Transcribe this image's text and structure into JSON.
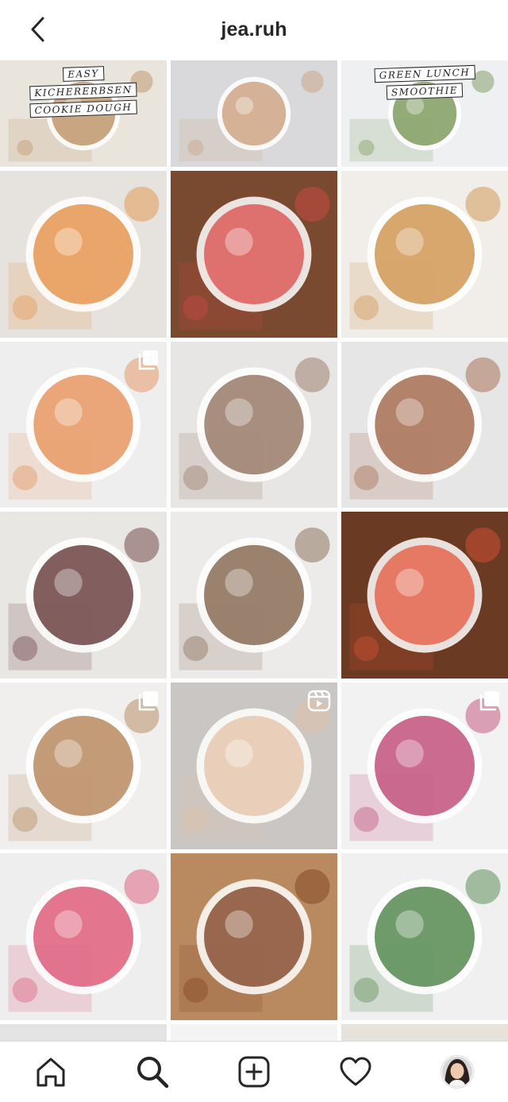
{
  "header": {
    "username": "jea.ruh"
  },
  "posts": [
    {
      "row": 0,
      "col": 0,
      "overlay": [
        "EASY",
        "KICHERERBSEN",
        "COOKIE DOUGH"
      ],
      "badge": "none",
      "bg": "#e9e4dc",
      "accent": "#b88a5a"
    },
    {
      "row": 0,
      "col": 1,
      "overlay": [],
      "badge": "none",
      "bg": "#d9d9dc",
      "accent": "#c89a76"
    },
    {
      "row": 0,
      "col": 2,
      "overlay": [
        "GREEN LUNCH",
        "SMOOTHIE"
      ],
      "badge": "none",
      "bg": "#eef0f2",
      "accent": "#6f8f4a"
    },
    {
      "row": 1,
      "col": 0,
      "overlay": [],
      "badge": "none",
      "bg": "#e6e3df",
      "accent": "#e48a3a"
    },
    {
      "row": 1,
      "col": 1,
      "overlay": [],
      "badge": "none",
      "bg": "#7a4a30",
      "accent": "#d94a48"
    },
    {
      "row": 1,
      "col": 2,
      "overlay": [],
      "badge": "none",
      "bg": "#f1ede8",
      "accent": "#c98a3e"
    },
    {
      "row": 2,
      "col": 0,
      "overlay": [],
      "badge": "carousel",
      "bg": "#eeeeee",
      "accent": "#e3884b"
    },
    {
      "row": 2,
      "col": 1,
      "overlay": [],
      "badge": "none",
      "bg": "#e8e6e4",
      "accent": "#8b6a55"
    },
    {
      "row": 2,
      "col": 2,
      "overlay": [],
      "badge": "none",
      "bg": "#e7e6e6",
      "accent": "#9a5a3a"
    },
    {
      "row": 3,
      "col": 0,
      "overlay": [],
      "badge": "none",
      "bg": "#e9e7e4",
      "accent": "#5a2a2a"
    },
    {
      "row": 3,
      "col": 1,
      "overlay": [],
      "badge": "none",
      "bg": "#ecebea",
      "accent": "#7a5a40"
    },
    {
      "row": 3,
      "col": 2,
      "overlay": [],
      "badge": "none",
      "bg": "#6b3a22",
      "accent": "#e4553a"
    },
    {
      "row": 4,
      "col": 0,
      "overlay": [],
      "badge": "carousel",
      "bg": "#f0efee",
      "accent": "#b07a4a"
    },
    {
      "row": 4,
      "col": 1,
      "overlay": [],
      "badge": "reel",
      "bg": "#c9c6c4",
      "accent": "#e4c2a4"
    },
    {
      "row": 4,
      "col": 2,
      "overlay": [],
      "badge": "carousel",
      "bg": "#f2f2f2",
      "accent": "#b83a6a"
    },
    {
      "row": 5,
      "col": 0,
      "overlay": [],
      "badge": "none",
      "bg": "#eeeeee",
      "accent": "#d9476a"
    },
    {
      "row": 5,
      "col": 1,
      "overlay": [],
      "badge": "none",
      "bg": "#b98a60",
      "accent": "#7a3a1a"
    },
    {
      "row": 5,
      "col": 2,
      "overlay": [],
      "badge": "none",
      "bg": "#f0f0f0",
      "accent": "#3f7a3a"
    }
  ],
  "tabs": [
    {
      "name": "home-tab",
      "icon": "home-icon"
    },
    {
      "name": "search-tab",
      "icon": "search-icon"
    },
    {
      "name": "create-tab",
      "icon": "plus-square-icon"
    },
    {
      "name": "activity-tab",
      "icon": "heart-icon"
    },
    {
      "name": "profile-tab",
      "icon": "avatar-icon"
    }
  ]
}
